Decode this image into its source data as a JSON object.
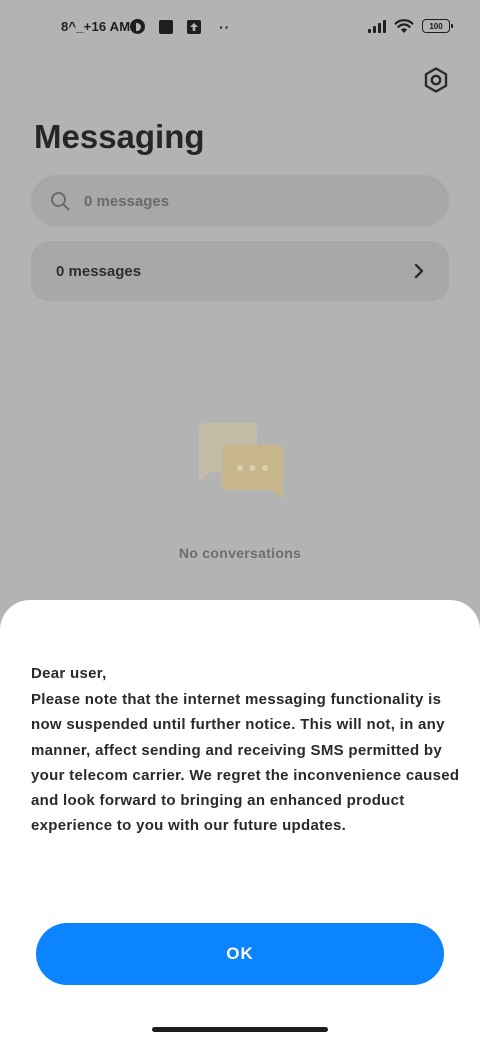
{
  "status_bar": {
    "time": "8^_+16 AM",
    "battery_level": "100",
    "more_indicator": "··"
  },
  "header": {
    "title": "Messaging",
    "settings_icon": "gear-icon"
  },
  "search": {
    "placeholder": "0 messages",
    "icon": "search-icon"
  },
  "messages_row": {
    "label": "0 messages",
    "icon": "chevron-right-icon"
  },
  "empty_state": {
    "icon": "chat-bubbles-icon",
    "text": "No conversations"
  },
  "dialog": {
    "greeting": "Dear user,",
    "body": "Please note that the internet messaging functionality is now suspended until further notice. This will not, in any manner, affect sending and receiving SMS permitted by your telecom carrier. We regret the inconvenience caused and look forward to bringing an enhanced product experience to you with our future updates.",
    "ok_label": "OK"
  },
  "colors": {
    "accent": "#0d84ff",
    "dim_background": "#b3b3b3",
    "sheet_background": "#ffffff",
    "illustration": "#e5cf9c"
  }
}
